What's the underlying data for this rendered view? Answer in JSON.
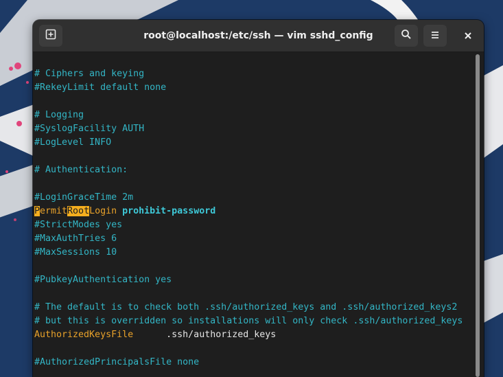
{
  "window": {
    "title": "root@localhost:/etc/ssh — vim sshd_config"
  },
  "icons": {
    "new_tab": "new-tab-icon",
    "search": "search-icon",
    "menu": "hamburger-menu-icon",
    "close": "close-icon"
  },
  "colors": {
    "comment": "#33b6c6",
    "keyword": "#e9a22a",
    "search_highlight": "#f5ae1e",
    "value": "#3ec9d8",
    "plain": "#e6e6e6",
    "terminal_bg": "#1e1e1e",
    "titlebar_bg": "#303030"
  },
  "editor": {
    "lines": {
      "l0": "# Ciphers and keying",
      "l1": "#RekeyLimit default none",
      "l3": "# Logging",
      "l4": "#SyslogFacility AUTH",
      "l5": "#LogLevel INFO",
      "l7": "# Authentication:",
      "l9": "#LoginGraceTime 2m",
      "l10": {
        "p1": "P",
        "p2": "ermit",
        "p3": "Root",
        "p4": "Login",
        "value": "prohibit-password"
      },
      "l11": "#StrictModes yes",
      "l12": "#MaxAuthTries 6",
      "l13": "#MaxSessions 10",
      "l15": "#PubkeyAuthentication yes",
      "l17": "# The default is to check both .ssh/authorized_keys and .ssh/authorized_keys2",
      "l18": "# but this is overridden so installations will only check .ssh/authorized_keys",
      "l19": {
        "key": "AuthorizedKeysFile",
        "value": ".ssh/authorized_keys"
      },
      "l21": "#AuthorizedPrincipalsFile none"
    }
  }
}
